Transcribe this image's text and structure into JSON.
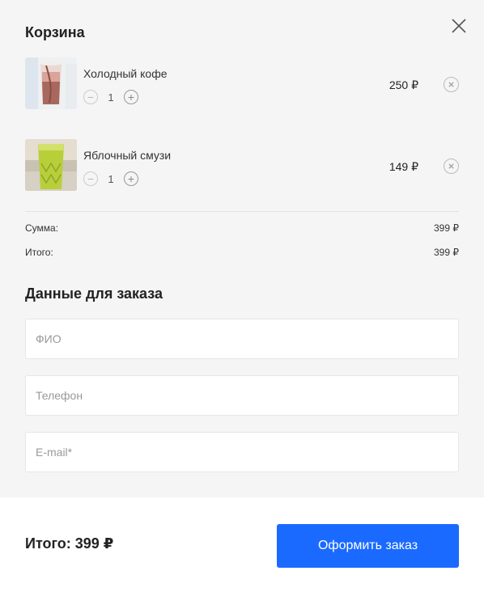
{
  "cart": {
    "title": "Корзина",
    "items": [
      {
        "name": "Холодный кофе",
        "quantity": "1",
        "price": "250 ₽",
        "qty_minus": "−",
        "qty_plus": "+"
      },
      {
        "name": "Яблочный смузи",
        "quantity": "1",
        "price": "149 ₽",
        "qty_minus": "−",
        "qty_plus": "+"
      }
    ],
    "summary": {
      "sum_label": "Сумма:",
      "sum_value": "399 ₽",
      "total_label": "Итого:",
      "total_value": "399 ₽"
    }
  },
  "order_form": {
    "title": "Данные для заказа",
    "fields": {
      "name_placeholder": "ФИО",
      "phone_placeholder": "Телефон",
      "email_placeholder": "E-mail*"
    }
  },
  "footer": {
    "total_text": "Итого: 399 ₽",
    "checkout_label": "Оформить заказ"
  },
  "colors": {
    "accent": "#1a6aff",
    "background": "#f5f5f6"
  },
  "icons": {
    "close": "close-icon",
    "remove": "remove-item-icon",
    "minus": "minus-icon",
    "plus": "plus-icon"
  }
}
